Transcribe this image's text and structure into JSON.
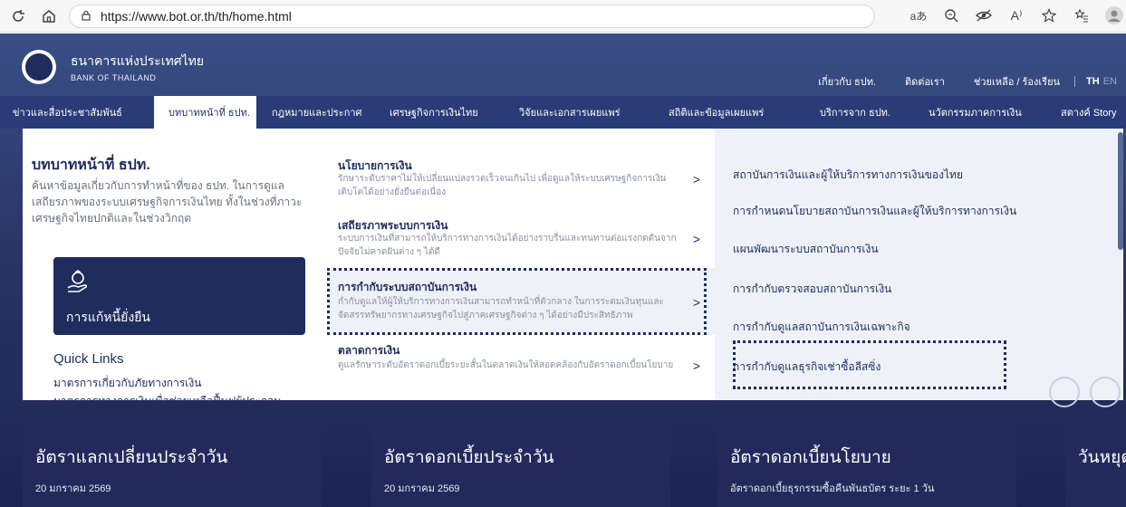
{
  "browser": {
    "url": "https://www.bot.or.th/th/home.html",
    "icons": [
      "refresh-icon",
      "home-icon",
      "lock-icon",
      "read-aloud-icon",
      "zoom-icon",
      "tracking-icon",
      "read-icon",
      "favorite-icon",
      "favorites-list-icon",
      "profile-avatar"
    ],
    "read_aloud_label": "aあ",
    "font_label": "A⁾"
  },
  "site": {
    "logo_th": "ธนาคารแห่งประเทศไทย",
    "logo_en": "BANK OF THAILAND",
    "top_links": [
      "เกี่ยวกับ ธปท.",
      "ติดต่อเรา",
      "ช่วยเหลือ / ร้องเรียน"
    ],
    "lang_th": "TH",
    "lang_en": "EN",
    "nav": [
      {
        "label": "ข่าวและสื่อประชาสัมพันธ์"
      },
      {
        "label": "บทบาทหน้าที่ ธปท."
      },
      {
        "label": "กฎหมายและประกาศ"
      },
      {
        "label": "เศรษฐกิจการเงินไทย"
      },
      {
        "label": "วิจัยและเอกสารเผยแพร่"
      },
      {
        "label": "สถิติและข้อมูลเผยแพร่"
      },
      {
        "label": "บริการจาก ธปท."
      },
      {
        "label": "นวัตกรรมภาคการเงิน"
      },
      {
        "label": "สตางค์ Story"
      }
    ]
  },
  "mega": {
    "title": "บทบาทหน้าที่ ธปท.",
    "desc": "ค้นหาข้อมูลเกี่ยวกับการทำหน้าที่ของ ธปท. ในการดูแลเสถียรภาพของระบบเศรษฐกิจการเงินไทย ทั้งในช่วงที่ภาวะเศรษฐกิจไทยปกติและในช่วงวิกฤต",
    "feature": "การแก้หนี้ยั่งยืน",
    "quick_links_title": "Quick Links",
    "quick_links": [
      "มาตรการเกี่ยวกับภัยทางการเงิน",
      "มาตรการทางการเงินเพื่อช่วยเหลือฟื้นฟูผู้ประกอบ"
    ],
    "middle": [
      {
        "title": "นโยบายการเงิน",
        "desc": "รักษาระดับราคาไม่ให้เปลี่ยนแปลงรวดเร็วจนเกินไป เพื่อดูแลให้ระบบเศรษฐกิจการเงินเติบโตได้อย่างยั่งยืนต่อเนื่อง"
      },
      {
        "title": "เสถียรภาพระบบการเงิน",
        "desc": "ระบบการเงินที่สามารถให้บริการทางการเงินได้อย่างราบรื่นและทนทานต่อแรงกดดันจากปัจจัยไม่คาดฝันต่าง ๆ ได้ดี"
      },
      {
        "title": "การกำกับระบบสถาบันการเงิน",
        "desc": "กำกับดูแลให้ผู้ให้บริการทางการเงินสามารถทำหน้าที่ตัวกลาง ในการระดมเงินทุนและจัดสรรทรัพยากรทางเศรษฐกิจไปสู่ภาคเศรษฐกิจต่าง ๆ ได้อย่างมีประสิทธิภาพ"
      },
      {
        "title": "ตลาดการเงิน",
        "desc": "ดูแลรักษาระดับอัตราดอกเบี้ยระยะสั้นในตลาดเงินให้สอดคล้องกับอัตราดอกเบี้ยนโยบาย"
      }
    ],
    "right": [
      "สถาบันการเงินและผู้ให้บริการทางการเงินของไทย",
      "การกำหนดนโยบายสถาบันการเงินและผู้ให้บริการทางการเงิน",
      "แผนพัฒนาระบบสถาบันการเงิน",
      "การกำกับตรวจสอบสถาบันการเงิน",
      "การกำกับดูแลสถาบันการเงินเฉพาะกิจ",
      "การกำกับดูแลธุรกิจเช่าซื้อลีสซิ่ง"
    ]
  },
  "cards": [
    {
      "title": "อัตราแลกเปลี่ยนประจำวัน",
      "sub": "20 มกราคม 2569"
    },
    {
      "title": "อัตราดอกเบี้ยประจำวัน",
      "sub": "20 มกราคม 2569"
    },
    {
      "title": "อัตราดอกเบี้ยนโยบาย",
      "sub": "อัตราดอกเบี้ยธุรกรรมซื้อคืนพันธบัตร ระยะ 1 วัน"
    },
    {
      "title": "วันหยุด",
      "sub": ""
    }
  ]
}
